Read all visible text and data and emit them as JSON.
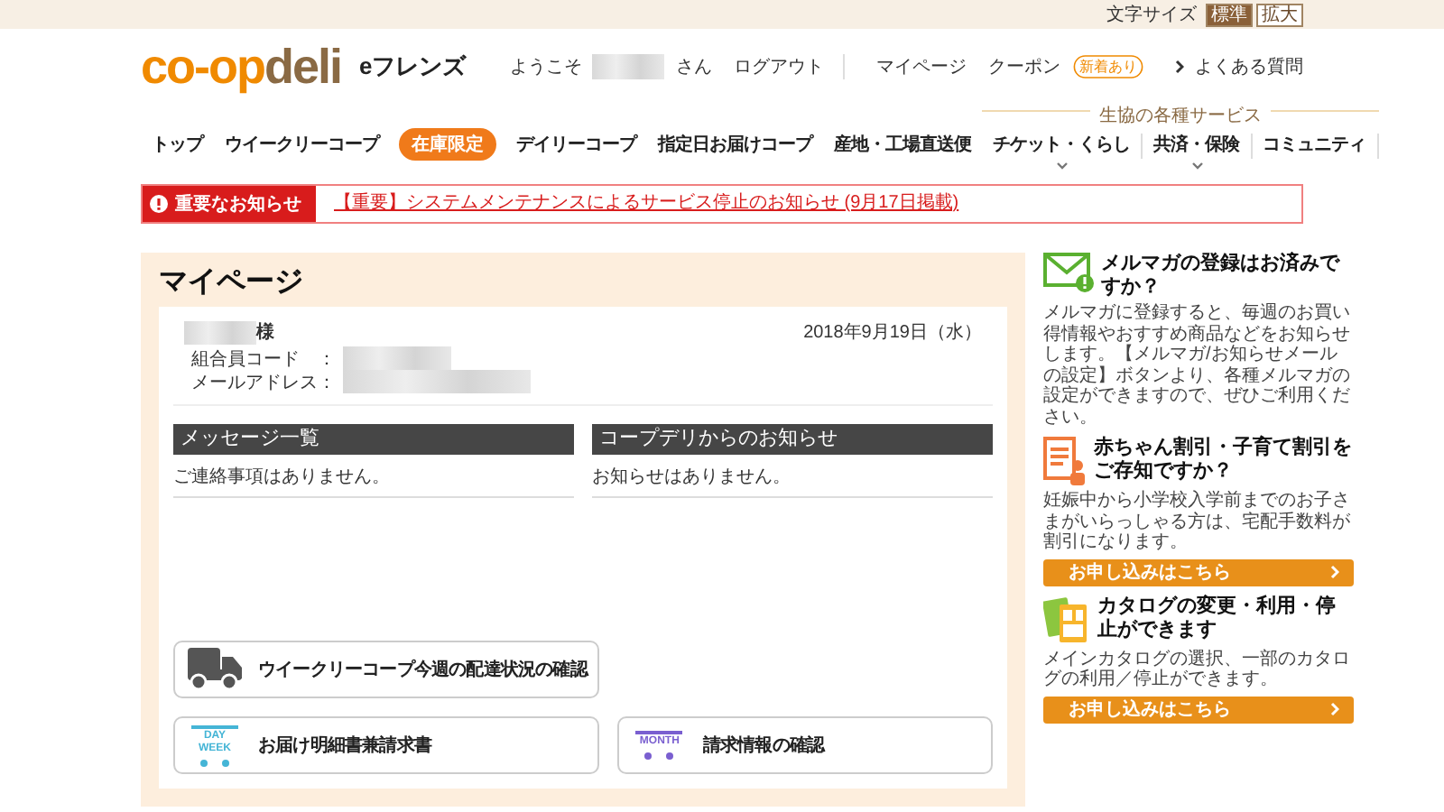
{
  "top_bar": {
    "label": "文字サイズ",
    "sizes": [
      {
        "label": "標準",
        "selected": true
      },
      {
        "label": "拡大",
        "selected": false
      }
    ]
  },
  "header": {
    "logo": {
      "part_1": "co-op",
      "part_2": "deli"
    },
    "subtitle": "eフレンズ",
    "welcome_prefix": "ようこそ",
    "welcome_suffix": "さん",
    "links": [
      {
        "label": "ログアウト"
      },
      {
        "label": "マイページ"
      },
      {
        "label": "クーポン",
        "badge": "新着あり"
      }
    ],
    "faq": "よくある質問"
  },
  "nav": {
    "items": [
      {
        "label": "トップ",
        "kind": "link"
      },
      {
        "label": "ウイークリーコープ",
        "kind": "link"
      },
      {
        "label": "在庫限定",
        "kind": "pill"
      },
      {
        "label": "デイリーコープ",
        "kind": "link"
      },
      {
        "label": "指定日お届けコープ",
        "kind": "link"
      },
      {
        "label": "産地・工場直送便",
        "kind": "link"
      }
    ],
    "services": {
      "label": "生協の各種サービス",
      "items": [
        {
          "label": "チケット・くらし",
          "dropdown": true
        },
        {
          "label": "共済・保険",
          "dropdown": true
        },
        {
          "label": "コミュニティ",
          "dropdown": false
        }
      ]
    }
  },
  "notice": {
    "label": "重要なお知らせ",
    "link": "【重要】システムメンテナンスによるサービス停止のお知らせ (9月17日掲載)"
  },
  "mypage": {
    "title": "マイページ",
    "honorific": "様",
    "date": "2018年9月19日（水）",
    "fields": [
      {
        "label": "組合員コード　："
      },
      {
        "label": "メールアドレス："
      }
    ],
    "columns": [
      {
        "heading": "メッセージ一覧",
        "text": "ご連絡事項はありません。"
      },
      {
        "heading": "コープデリからのお知らせ",
        "text": "お知らせはありません。"
      }
    ],
    "actions": [
      {
        "kind": "truck",
        "label": "ウイークリーコープ今週の配達状況の確認"
      },
      {
        "kind": "cart",
        "icon_text": [
          "DAY",
          "WEEK"
        ],
        "color": "#45b5d6",
        "label": "お届け明細書兼請求書"
      },
      {
        "kind": "cart",
        "icon_text": [
          "MONTH"
        ],
        "color": "#7a5fd0",
        "label": "請求情報の確認"
      }
    ]
  },
  "sidebar": [
    {
      "kind": "mail",
      "title": "メルマガの登録はお済みですか？",
      "text": "メルマガに登録すると、毎週のお買い得情報やおすすめ商品などをお知らせします。【メルマガ/お知らせメールの設定】ボタンより、各種メルマガの設定ができますので、ぜひご利用ください。"
    },
    {
      "kind": "document",
      "title": "赤ちゃん割引・子育て割引をご存知ですか？",
      "text": "妊娠中から小学校入学前までのお子さまがいらっしゃる方は、宅配手数料が割引になります。",
      "button": "お申し込みはこちら"
    },
    {
      "kind": "catalog",
      "title": "カタログの変更・利用・停止ができます",
      "text": "メインカタログの選択、一部のカタログの利用／停止ができます。",
      "button": "お申し込みはこちら"
    }
  ]
}
